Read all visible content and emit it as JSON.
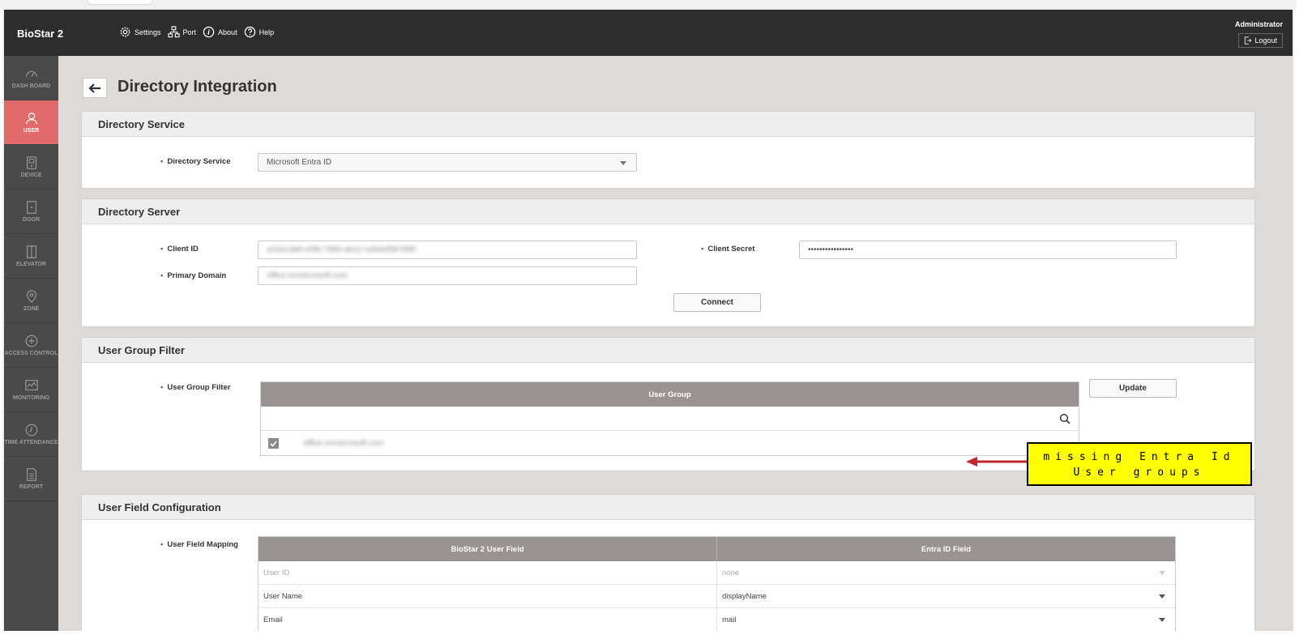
{
  "header": {
    "brand": "BioStar 2",
    "nav": [
      {
        "label": "Settings",
        "icon": "gear-icon"
      },
      {
        "label": "Port",
        "icon": "network-icon"
      },
      {
        "label": "About",
        "icon": "info-icon"
      },
      {
        "label": "Help",
        "icon": "help-icon"
      }
    ],
    "user": "Administrator",
    "logout_label": "Logout"
  },
  "sidebar": {
    "items": [
      {
        "label": "DASH BOARD",
        "icon": "gauge-icon",
        "active": false
      },
      {
        "label": "USER",
        "icon": "user-icon",
        "active": true
      },
      {
        "label": "DEVICE",
        "icon": "device-icon",
        "active": false
      },
      {
        "label": "DOOR",
        "icon": "door-icon",
        "active": false
      },
      {
        "label": "ELEVATOR",
        "icon": "elevator-icon",
        "active": false
      },
      {
        "label": "ZONE",
        "icon": "zone-pin-icon",
        "active": false
      },
      {
        "label": "ACCESS CONTROL",
        "icon": "access-control-icon",
        "active": false
      },
      {
        "label": "MONITORING",
        "icon": "monitoring-icon",
        "active": false
      },
      {
        "label": "TIME ATTENDANCE",
        "icon": "clock-icon",
        "active": false
      },
      {
        "label": "REPORT",
        "icon": "report-icon",
        "active": false
      }
    ]
  },
  "page": {
    "title": "Directory Integration"
  },
  "directory_service": {
    "section_title": "Directory Service",
    "label": "Directory Service",
    "value": "Microsoft Entra ID"
  },
  "directory_server": {
    "section_title": "Directory Server",
    "client_id_label": "Client ID",
    "client_id_value": "a1b2c3d4-e5f6-7890-ab12-cd34ef567890",
    "client_secret_label": "Client Secret",
    "client_secret_value": "••••••••••••••••",
    "primary_domain_label": "Primary Domain",
    "primary_domain_value": "office.onmicrosoft.com",
    "connect_label": "Connect"
  },
  "user_group_filter": {
    "section_title": "User Group Filter",
    "label": "User Group Filter",
    "table_header": "User Group",
    "row_value": "office.onmicrosoft.com",
    "update_label": "Update"
  },
  "user_field_config": {
    "section_title": "User Field Configuration",
    "label": "User Field Mapping",
    "columns": [
      "BioStar 2 User Field",
      "Entra ID Field"
    ],
    "rows": [
      {
        "field": "User ID",
        "mapped": "none",
        "disabled": true
      },
      {
        "field": "User Name",
        "mapped": "displayName",
        "disabled": false
      },
      {
        "field": "Email",
        "mapped": "mail",
        "disabled": false
      }
    ]
  },
  "annotation": {
    "line1": "missing Entra Id",
    "line2": "User groups",
    "color": "#ffff00",
    "arrow_color": "#c0272d"
  },
  "colors": {
    "header_bg": "#2d2d2d",
    "sidebar_bg": "#4a4a4a",
    "active_accent": "#e26a6a",
    "table_header_bg": "#9a9393"
  }
}
